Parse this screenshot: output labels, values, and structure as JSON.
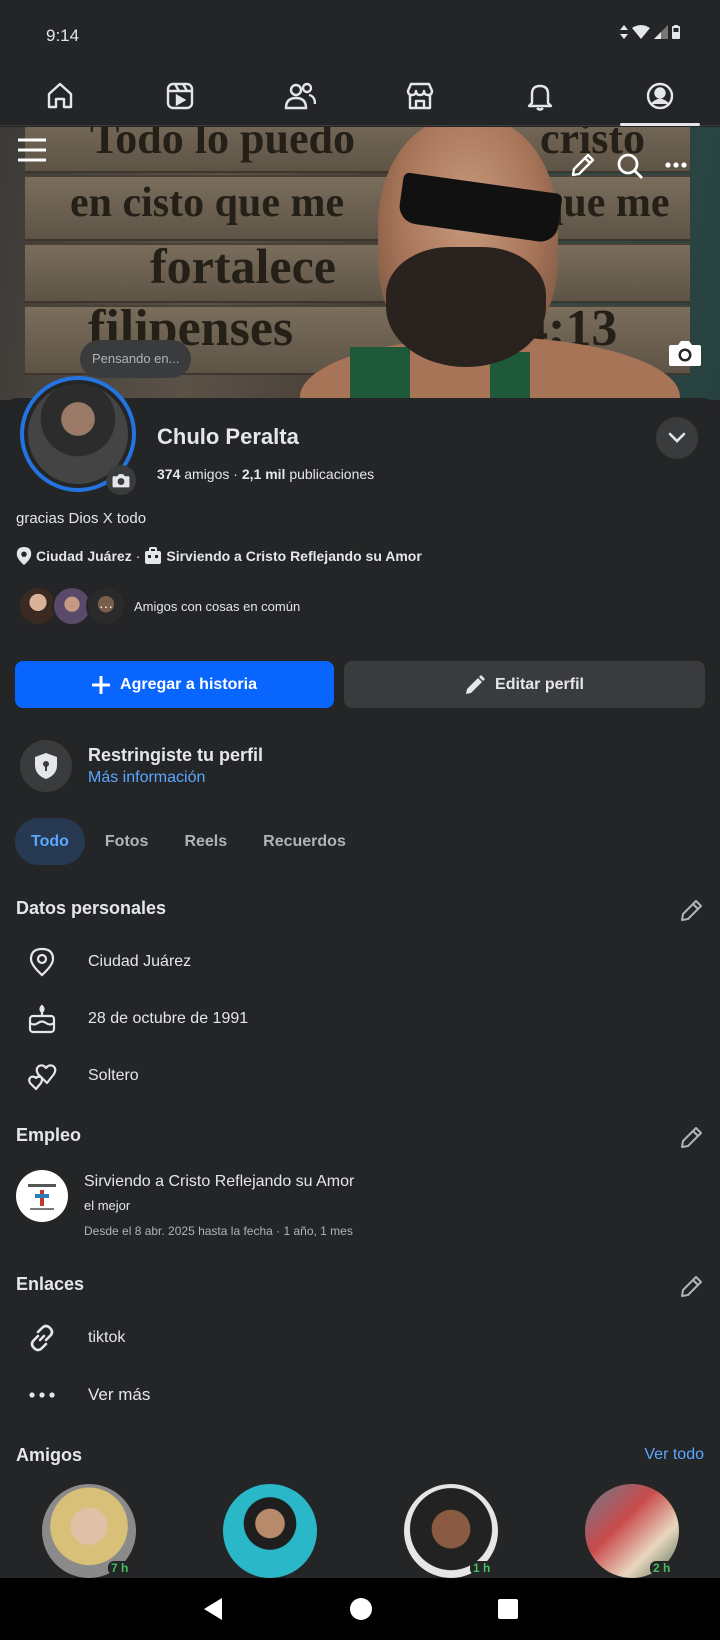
{
  "status_bar": {
    "time": "9:14"
  },
  "nav_tabs": [
    {
      "name": "home",
      "icon": "home-icon"
    },
    {
      "name": "reels",
      "icon": "video-icon"
    },
    {
      "name": "friends",
      "icon": "friends-icon"
    },
    {
      "name": "marketplace",
      "icon": "store-icon"
    },
    {
      "name": "notifications",
      "icon": "bell-icon"
    },
    {
      "name": "profile",
      "icon": "profile-icon",
      "active": true
    }
  ],
  "cover": {
    "text_lines": [
      "Todo lo puedo",
      "cristo",
      "en cisto que me",
      "que me",
      "fortalece",
      "filipenses",
      "4;13"
    ]
  },
  "thinking_bubble": "Pensando en...",
  "profile": {
    "name": "Chulo Peralta",
    "friends_count": "374",
    "friends_label": "amigos",
    "posts_count": "2,1 mil",
    "posts_label": "publicaciones",
    "bio": "gracias Dios X todo",
    "location": "Ciudad Juárez",
    "workplace": "Sirviendo a Cristo Reflejando su Amor",
    "mutual_text": "Amigos con cosas en común"
  },
  "buttons": {
    "add_story": "Agregar a historia",
    "edit_profile": "Editar perfil"
  },
  "restricted": {
    "title": "Restringiste tu perfil",
    "link": "Más información"
  },
  "tabs": [
    "Todo",
    "Fotos",
    "Reels",
    "Recuerdos"
  ],
  "personal": {
    "title": "Datos personales",
    "location": "Ciudad Juárez",
    "birthday": "28 de octubre de 1991",
    "relationship": "Soltero"
  },
  "employment": {
    "title": "Empleo",
    "company": "Sirviendo a Cristo Reflejando su Amor",
    "position": "el mejor",
    "dates": "Desde el 8 abr. 2025 hasta la fecha · 1 año, 1 mes"
  },
  "links": {
    "title": "Enlaces",
    "tiktok": "tiktok",
    "see_more": "Ver más"
  },
  "friends": {
    "title": "Amigos",
    "see_all": "Ver todo",
    "items": [
      {
        "time": "7 h"
      },
      {
        "time": ""
      },
      {
        "time": "1 h"
      },
      {
        "time": "2 h"
      }
    ]
  },
  "colors": {
    "background": "#242526",
    "accent": "#0866ff",
    "link": "#5aa7ff",
    "online": "#45bd62"
  }
}
